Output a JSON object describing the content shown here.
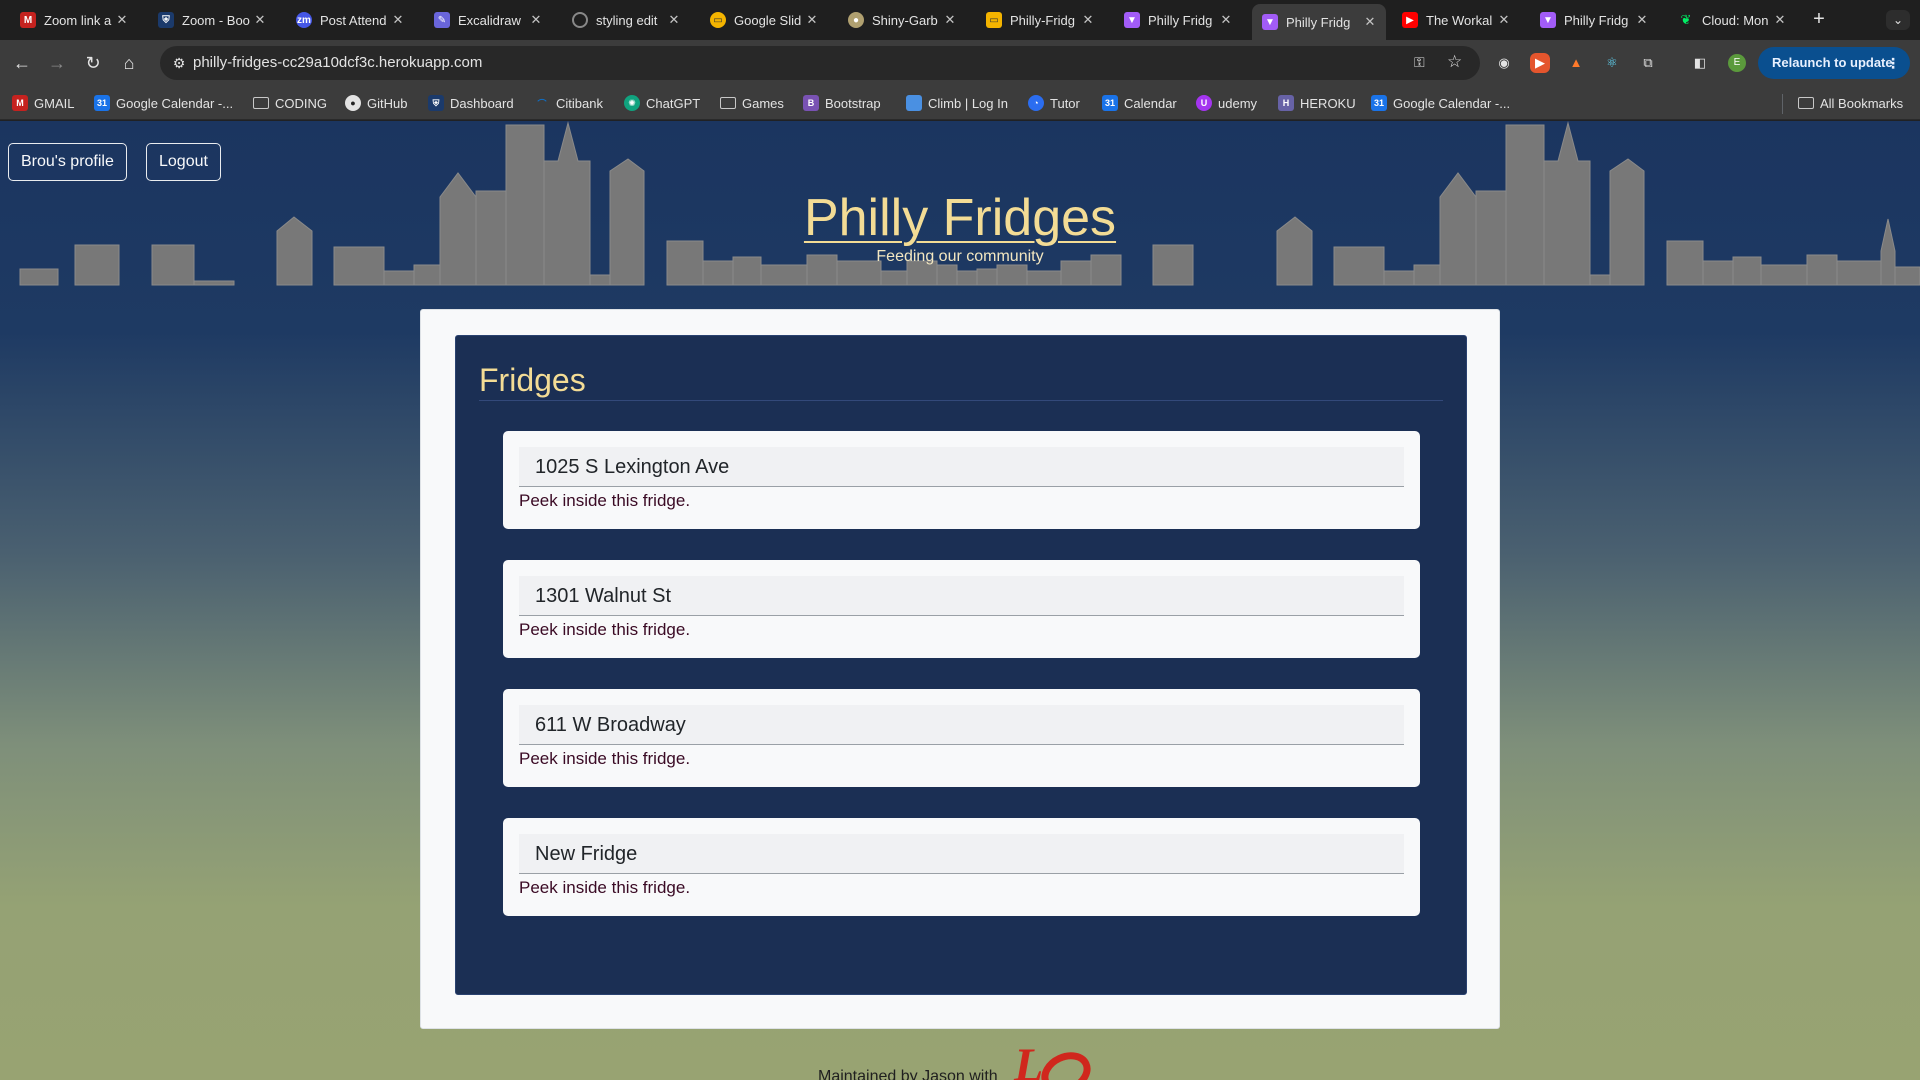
{
  "browser": {
    "tabs": [
      {
        "title": "Zoom link a",
        "favicon": "gmail-icon",
        "color": "#c5221f"
      },
      {
        "title": "Zoom - Boo",
        "favicon": "penn-shield-icon",
        "color": "#1b3a6b"
      },
      {
        "title": "Post Attend",
        "favicon": "zm-icon",
        "color": "#4557e6"
      },
      {
        "title": "Excalidraw",
        "favicon": "excalidraw-icon",
        "color": "#6965db"
      },
      {
        "title": "styling edit",
        "favicon": "loading-icon",
        "color": "#888888"
      },
      {
        "title": "Google Slid",
        "favicon": "google-slides-icon",
        "color": "#f4b400"
      },
      {
        "title": "Shiny-Garb",
        "favicon": "shiny-icon",
        "color": "#b0a070"
      },
      {
        "title": "Philly-Fridg",
        "favicon": "slides-icon",
        "color": "#f4b400"
      },
      {
        "title": "Philly Fridg",
        "favicon": "vite-icon",
        "color": "#a25cf7"
      },
      {
        "title": "Philly Fridg",
        "favicon": "vite-icon",
        "color": "#a25cf7"
      },
      {
        "title": "The Workal",
        "favicon": "youtube-icon",
        "color": "#ff0000"
      },
      {
        "title": "Philly Fridg",
        "favicon": "vite-icon",
        "color": "#a25cf7"
      },
      {
        "title": "Cloud: Mon",
        "favicon": "mongodb-leaf-icon",
        "color": "#00ed64"
      }
    ],
    "active_tab": 9,
    "url": "philly-fridges-cc29a10dcf3c.herokuapp.com",
    "relaunch_label": "Relaunch to update",
    "profile_initial": "E",
    "bookmarks": [
      {
        "label": "GMAIL",
        "icon": "gmail-icon",
        "color": "#c5221f"
      },
      {
        "label": "Google Calendar -...",
        "icon": "calendar-icon",
        "color": "#1a73e8"
      },
      {
        "label": "CODING",
        "icon": "folder-icon",
        "color": ""
      },
      {
        "label": "GitHub",
        "icon": "github-icon",
        "color": "#e3e3e3"
      },
      {
        "label": "Dashboard",
        "icon": "penn-shield-icon",
        "color": "#1b3a6b"
      },
      {
        "label": "Citibank",
        "icon": "citi-icon",
        "color": "#0f6fc6"
      },
      {
        "label": "ChatGPT",
        "icon": "chatgpt-icon",
        "color": "#10a37f"
      },
      {
        "label": "Games",
        "icon": "folder-icon",
        "color": ""
      },
      {
        "label": "Bootstrap",
        "icon": "bootstrap-icon",
        "color": "#7952b3"
      },
      {
        "label": "Climb | Log In",
        "icon": "climb-icon",
        "color": "#4a90e2"
      },
      {
        "label": "Tutor",
        "icon": "tutor-icon",
        "color": "#2b6df0"
      },
      {
        "label": "Calendar",
        "icon": "calendar-icon",
        "color": "#1a73e8"
      },
      {
        "label": "udemy",
        "icon": "udemy-icon",
        "color": "#a435f0"
      },
      {
        "label": "HEROKU",
        "icon": "heroku-icon",
        "color": "#6762a6"
      },
      {
        "label": "Google Calendar -...",
        "icon": "calendar-icon",
        "color": "#1a73e8"
      }
    ],
    "all_bookmarks_label": "All Bookmarks"
  },
  "site": {
    "profile_button": "Brou's profile",
    "logout_button": "Logout",
    "title": "Philly Fridges",
    "subtitle": "Feeding our community",
    "section_title": "Fridges",
    "fridges": [
      {
        "name": "1025 S Lexington Ave",
        "link": "Peek inside this fridge."
      },
      {
        "name": "1301 Walnut St",
        "link": "Peek inside this fridge."
      },
      {
        "name": "611 W Broadway",
        "link": "Peek inside this fridge."
      },
      {
        "name": "New Fridge",
        "link": "Peek inside this fridge."
      }
    ],
    "footer_text": "Maintained by Jason with",
    "colors": {
      "title_gold": "#f3dc95",
      "panel_navy": "#1b2f54",
      "link_maroon": "#3a0a24"
    }
  }
}
